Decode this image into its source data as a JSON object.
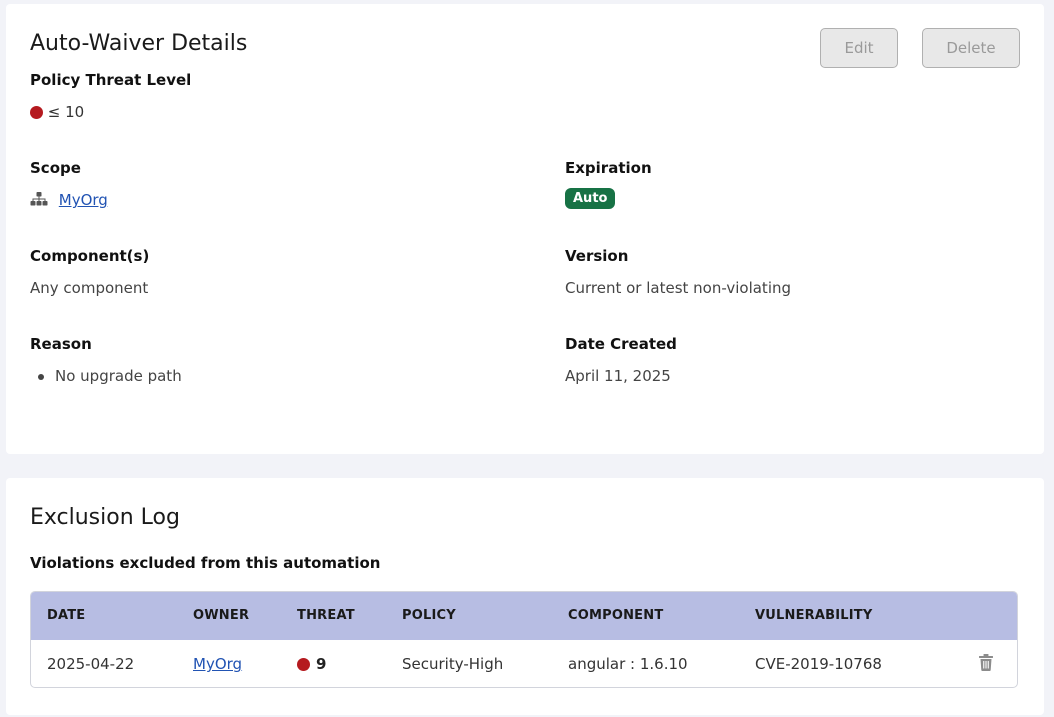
{
  "details": {
    "title": "Auto-Waiver Details",
    "edit_label": "Edit",
    "delete_label": "Delete",
    "threat_level_label": "Policy Threat Level",
    "threat_level_value": "≤ 10",
    "threat_color": "#b51a1f",
    "scope_label": "Scope",
    "scope_value": "MyOrg",
    "expiration_label": "Expiration",
    "expiration_value": "Auto",
    "expiration_badge_color": "#177245",
    "components_label": "Component(s)",
    "components_value": "Any component",
    "version_label": "Version",
    "version_value": "Current or latest non-violating",
    "reason_label": "Reason",
    "reason_items": [
      "No upgrade path"
    ],
    "date_created_label": "Date Created",
    "date_created_value": "April 11, 2025"
  },
  "exclusion_log": {
    "title": "Exclusion Log",
    "subtitle": "Violations excluded from this automation",
    "header_color": "#b7bde3",
    "columns": [
      "DATE",
      "OWNER",
      "THREAT",
      "POLICY",
      "COMPONENT",
      "VULNERABILITY"
    ],
    "rows": [
      {
        "date": "2025-04-22",
        "owner": "MyOrg",
        "threat": "9",
        "policy": "Security-High",
        "component": "angular : 1.6.10",
        "vulnerability": "CVE-2019-10768",
        "action_icon": "trash-icon"
      }
    ]
  }
}
